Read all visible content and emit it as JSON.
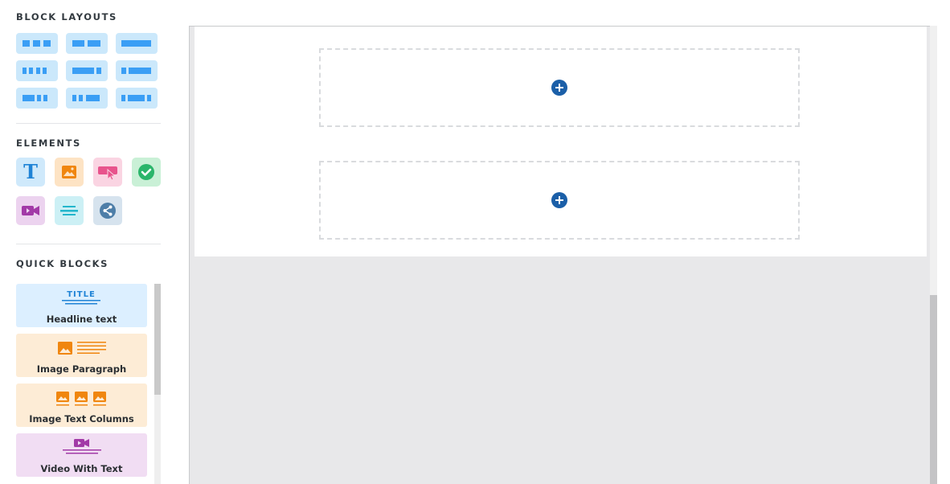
{
  "sidebar": {
    "block_layouts": {
      "title": "BLOCK LAYOUTS",
      "items": [
        "three-equal",
        "two-equal",
        "single",
        "four-equal",
        "wide-narrow",
        "narrow-wide",
        "two-wide-one-narrow",
        "two-narrow-one-wide",
        "narrow-wide-narrow"
      ]
    },
    "elements": {
      "title": "ELEMENTS",
      "items": [
        {
          "icon": "text-icon",
          "glyph": "T",
          "color": "#1f83d6",
          "bg": "#cfe9fb"
        },
        {
          "icon": "image-icon",
          "color": "#f0860f",
          "bg": "#fde3c4"
        },
        {
          "icon": "button-icon",
          "color": "#e8538c",
          "bg": "#fad4e2"
        },
        {
          "icon": "checkmark-icon",
          "color": "#2ab56a",
          "bg": "#c9f0d6"
        },
        {
          "icon": "video-icon",
          "color": "#a23aa7",
          "bg": "#ecd3ef"
        },
        {
          "icon": "divider-icon",
          "color": "#22b6cc",
          "bg": "#ccf0f5"
        },
        {
          "icon": "share-icon",
          "color": "#4d7ea8",
          "bg": "#d6e3ee"
        }
      ]
    },
    "quick_blocks": {
      "title": "QUICK BLOCKS",
      "items": [
        {
          "label": "Headline text",
          "title_glyph": "TITLE",
          "bg": "#dcefff",
          "accent": "#1f83d6"
        },
        {
          "label": "Image Paragraph",
          "bg": "#fdecd6",
          "accent": "#f0860f"
        },
        {
          "label": "Image Text Columns",
          "bg": "#fdecd6",
          "accent": "#f0860f"
        },
        {
          "label": "Video With Text",
          "bg": "#f1ddf3",
          "accent": "#a23aa7"
        }
      ]
    }
  },
  "canvas": {
    "drop_zones": 2,
    "add_button_color": "#1b5fa8"
  }
}
